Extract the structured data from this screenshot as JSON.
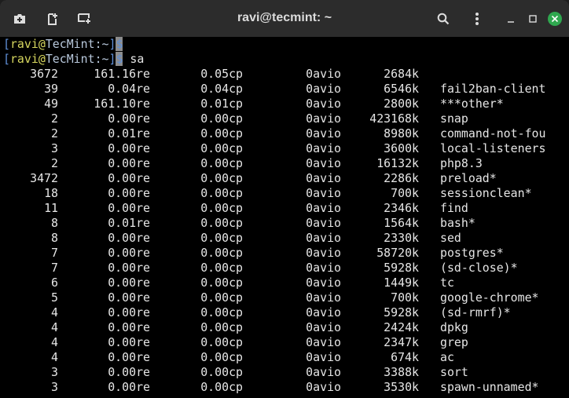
{
  "window": {
    "title": "ravi@tecmint: ~",
    "close_color": "#2fa84f"
  },
  "toolbar_icons": [
    "new-tab-icon",
    "split-icon",
    "new-window-icon",
    "search-icon",
    "menu-icon",
    "minimize-icon",
    "maximize-icon",
    "close-icon"
  ],
  "prompt": {
    "open": "[",
    "user": "ravi",
    "at": "@",
    "host": "TecMint:~",
    "close": "]",
    "symbol": "$",
    "command": "sa"
  },
  "rows": [
    [
      "3672",
      "161.16re",
      "0.05cp",
      "0avio",
      "2684k",
      ""
    ],
    [
      "39",
      "0.04re",
      "0.04cp",
      "0avio",
      "6546k",
      "fail2ban-client"
    ],
    [
      "49",
      "161.10re",
      "0.01cp",
      "0avio",
      "2800k",
      "***other*"
    ],
    [
      "2",
      "0.00re",
      "0.00cp",
      "0avio",
      "423168k",
      "snap"
    ],
    [
      "2",
      "0.01re",
      "0.00cp",
      "0avio",
      "8980k",
      "command-not-fou"
    ],
    [
      "3",
      "0.00re",
      "0.00cp",
      "0avio",
      "3600k",
      "local-listeners"
    ],
    [
      "2",
      "0.00re",
      "0.00cp",
      "0avio",
      "16132k",
      "php8.3"
    ],
    [
      "3472",
      "0.00re",
      "0.00cp",
      "0avio",
      "2286k",
      "preload*"
    ],
    [
      "18",
      "0.00re",
      "0.00cp",
      "0avio",
      "700k",
      "sessionclean*"
    ],
    [
      "11",
      "0.00re",
      "0.00cp",
      "0avio",
      "2346k",
      "find"
    ],
    [
      "8",
      "0.01re",
      "0.00cp",
      "0avio",
      "1564k",
      "bash*"
    ],
    [
      "8",
      "0.00re",
      "0.00cp",
      "0avio",
      "2330k",
      "sed"
    ],
    [
      "7",
      "0.00re",
      "0.00cp",
      "0avio",
      "58720k",
      "postgres*"
    ],
    [
      "7",
      "0.00re",
      "0.00cp",
      "0avio",
      "5928k",
      "(sd-close)*"
    ],
    [
      "6",
      "0.00re",
      "0.00cp",
      "0avio",
      "1449k",
      "tc"
    ],
    [
      "5",
      "0.00re",
      "0.00cp",
      "0avio",
      "700k",
      "google-chrome*"
    ],
    [
      "4",
      "0.00re",
      "0.00cp",
      "0avio",
      "5928k",
      "(sd-rmrf)*"
    ],
    [
      "4",
      "0.00re",
      "0.00cp",
      "0avio",
      "2424k",
      "dpkg"
    ],
    [
      "4",
      "0.00re",
      "0.00cp",
      "0avio",
      "2347k",
      "grep"
    ],
    [
      "4",
      "0.00re",
      "0.00cp",
      "0avio",
      "674k",
      "ac"
    ],
    [
      "3",
      "0.00re",
      "0.00cp",
      "0avio",
      "3388k",
      "sort"
    ],
    [
      "3",
      "0.00re",
      "0.00cp",
      "0avio",
      "3530k",
      "spawn-unnamed*"
    ]
  ]
}
